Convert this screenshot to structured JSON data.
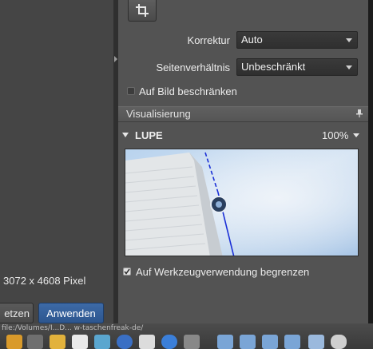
{
  "canvas": {
    "dimensions_text": "3072 x 4608 Pixel"
  },
  "buttons": {
    "cancel_label": "etzen",
    "apply_label": "Anwenden"
  },
  "crop_tool": {
    "icon": "crop-icon"
  },
  "correction": {
    "label": "Korrektur",
    "value": "Auto"
  },
  "aspect_ratio": {
    "label": "Seitenverhältnis",
    "value": "Unbeschränkt"
  },
  "constrain": {
    "label": "Auf Bild beschränken",
    "checked": false
  },
  "visualization": {
    "title": "Visualisierung",
    "pin_icon": "pin-icon"
  },
  "loupe": {
    "label": "LUPE",
    "zoom": "100%"
  },
  "limit_tool": {
    "label": "Auf Werkzeugverwendung begrenzen",
    "checked": true
  },
  "dock": {
    "path_text": "file:/Volumes/I...D... w-taschenfreak-de/"
  },
  "colors": {
    "accent": "#2d568f",
    "panel": "#535353",
    "sky": "#c9dcef",
    "guide_line": "#1a2fd6"
  }
}
